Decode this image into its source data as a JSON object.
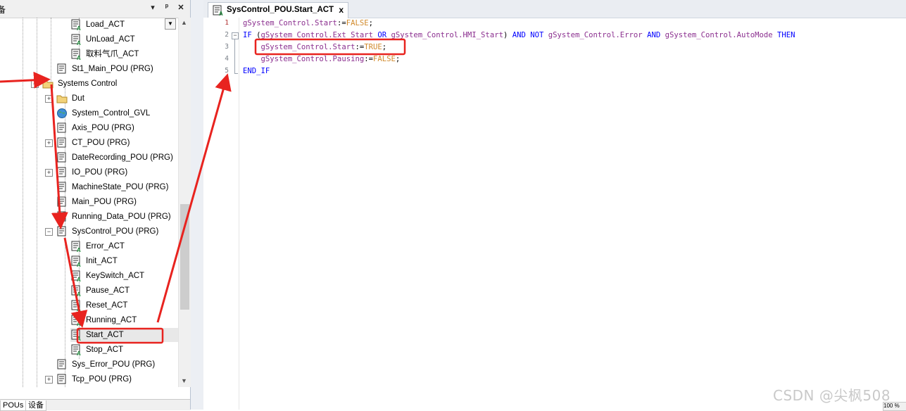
{
  "left_panel": {
    "title": "备",
    "pin_glyph": "▾",
    "dock_glyph": "ᵖ",
    "close_glyph": "✕",
    "tree": [
      {
        "label": "Load_ACT",
        "type": "action"
      },
      {
        "label": "UnLoad_ACT",
        "type": "action"
      },
      {
        "label": "取料气爪_ACT",
        "type": "action"
      },
      {
        "label": "St1_Main_POU (PRG)",
        "type": "pou"
      },
      {
        "label": "Systems Control",
        "type": "folder"
      },
      {
        "label": "Dut",
        "type": "folder"
      },
      {
        "label": "System_Control_GVL",
        "type": "gvl"
      },
      {
        "label": "Axis_POU (PRG)",
        "type": "pou"
      },
      {
        "label": "CT_POU (PRG)",
        "type": "pou"
      },
      {
        "label": "DateRecording_POU (PRG)",
        "type": "pou"
      },
      {
        "label": "IO_POU (PRG)",
        "type": "pou"
      },
      {
        "label": "MachineState_POU (PRG)",
        "type": "pou"
      },
      {
        "label": "Main_POU (PRG)",
        "type": "pou"
      },
      {
        "label": "Running_Data_POU (PRG)",
        "type": "pou"
      },
      {
        "label": "SysControl_POU (PRG)",
        "type": "pou"
      },
      {
        "label": "Error_ACT",
        "type": "action"
      },
      {
        "label": "Init_ACT",
        "type": "action"
      },
      {
        "label": "KeySwitch_ACT",
        "type": "action"
      },
      {
        "label": "Pause_ACT",
        "type": "action"
      },
      {
        "label": "Reset_ACT",
        "type": "action"
      },
      {
        "label": "Running_ACT",
        "type": "action"
      },
      {
        "label": "Start_ACT",
        "type": "action"
      },
      {
        "label": "Stop_ACT",
        "type": "action"
      },
      {
        "label": "Sys_Error_POU (PRG)",
        "type": "pou"
      },
      {
        "label": "Tcp_POU (PRG)",
        "type": "pou"
      }
    ],
    "bottom_tabs": [
      "POUs",
      "设备"
    ]
  },
  "editor": {
    "tab_label": "SysControl_POU.Start_ACT",
    "tab_close": "x",
    "line_numbers": [
      "1",
      "2",
      "3",
      "4",
      "5"
    ],
    "fold_markers": [
      "−",
      "−"
    ],
    "lines": [
      [
        {
          "t": "gSystem_Control.Start",
          "c": "id"
        },
        {
          "t": ":=",
          "c": "op"
        },
        {
          "t": "FALSE",
          "c": "lit"
        },
        {
          "t": ";",
          "c": "op"
        }
      ],
      [
        {
          "t": "IF",
          "c": "kw"
        },
        {
          "t": " (",
          "c": "op"
        },
        {
          "t": "gSystem_Control.Ext_Start",
          "c": "id"
        },
        {
          "t": " OR ",
          "c": "kw"
        },
        {
          "t": "gSystem_Control.HMI_Start",
          "c": "id"
        },
        {
          "t": ") ",
          "c": "op"
        },
        {
          "t": "AND NOT ",
          "c": "kw"
        },
        {
          "t": "gSystem_Control.Error",
          "c": "id"
        },
        {
          "t": " AND ",
          "c": "kw"
        },
        {
          "t": "gSystem_Control.AutoMode",
          "c": "id"
        },
        {
          "t": " THEN",
          "c": "kw"
        }
      ],
      [
        {
          "t": "    gSystem_Control.Start",
          "c": "id"
        },
        {
          "t": ":=",
          "c": "op"
        },
        {
          "t": "TRUE",
          "c": "lit"
        },
        {
          "t": ";",
          "c": "op"
        }
      ],
      [
        {
          "t": "    gSystem_Control.Pausing",
          "c": "id"
        },
        {
          "t": ":=",
          "c": "op"
        },
        {
          "t": "FALSE",
          "c": "lit"
        },
        {
          "t": ";",
          "c": "op"
        }
      ],
      [
        {
          "t": "END_IF",
          "c": "kw"
        }
      ]
    ],
    "zoom_fragment": "100 %"
  },
  "watermark": "CSDN @尖枫508",
  "colors": {
    "annotation_red": "#e8231f",
    "keyword": "#0000ff",
    "identifier": "#8b2f8f",
    "literal": "#d18a2c"
  }
}
